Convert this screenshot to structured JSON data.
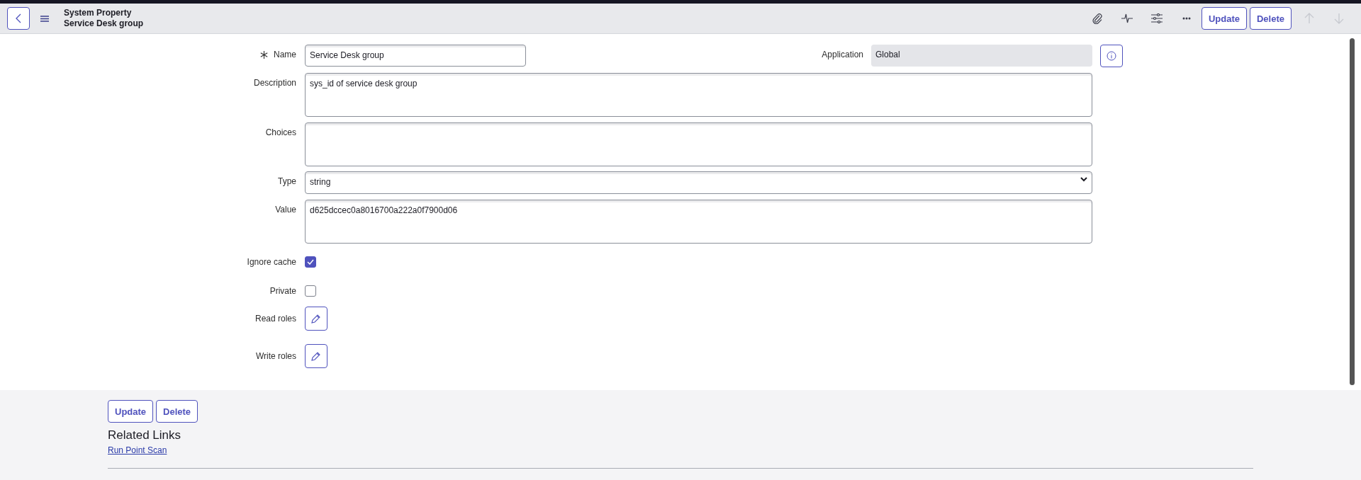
{
  "header": {
    "title": "System Property",
    "subtitle": "Service Desk group",
    "actions": [
      {
        "label": "Update"
      },
      {
        "label": "Delete"
      }
    ],
    "nav": [
      {
        "kind": "up",
        "disabled": true
      },
      {
        "kind": "down",
        "disabled": true
      }
    ]
  },
  "name_row": {
    "label": "Name",
    "required": true,
    "value": "Service Desk group",
    "application": {
      "label": "Application",
      "value": "Global",
      "readonly": true
    }
  },
  "fields": [
    {
      "kind": "textarea",
      "label": "Description",
      "value": "sys_id of service desk group"
    },
    {
      "kind": "textarea",
      "label": "Choices"
    },
    {
      "kind": "select",
      "label": "Type",
      "value": "string"
    },
    {
      "kind": "textarea",
      "label": "Value",
      "value": "d625dccec0a8016700a222a0f7900d06"
    },
    {
      "kind": "checkbox",
      "label": "Ignore cache",
      "checked": true
    },
    {
      "kind": "checkbox",
      "label": "Private",
      "checked": false
    },
    {
      "kind": "roles",
      "label": "Read roles"
    },
    {
      "kind": "roles",
      "label": "Write roles"
    }
  ],
  "footer": {
    "buttons": [
      {
        "label": "Update"
      },
      {
        "label": "Delete"
      }
    ],
    "related_title": "Related Links",
    "links": [
      "Run Point Scan"
    ]
  }
}
